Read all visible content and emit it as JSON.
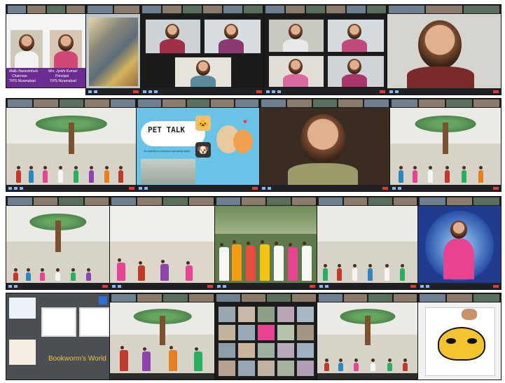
{
  "banner": {
    "chairman_name": "Mallu Narasimhulu",
    "chairman_title": "Chairman",
    "principal_name": "Mrs. Jyothi Kumari",
    "principal_title": "Principal",
    "org": "TIPS Nizamabad"
  },
  "pet_talk": {
    "title": "PET TALK",
    "subtitle": "An activity to enhance speaking skills"
  },
  "bookworm": {
    "title": "Bookworm's World"
  },
  "colors": {
    "meeting_bg": "#202124",
    "control_accent": "#8ab4f8",
    "end_button": "#e53935",
    "banner_purple": "#6a2c91",
    "pet_talk_bg": "#69c3e6",
    "bookworm_bg": "#4b4f53",
    "stage_blue": "#1f3c8f"
  },
  "icons": [
    "pet-talk-emoji-cat",
    "pet-talk-emoji-dog",
    "heart-icon"
  ]
}
